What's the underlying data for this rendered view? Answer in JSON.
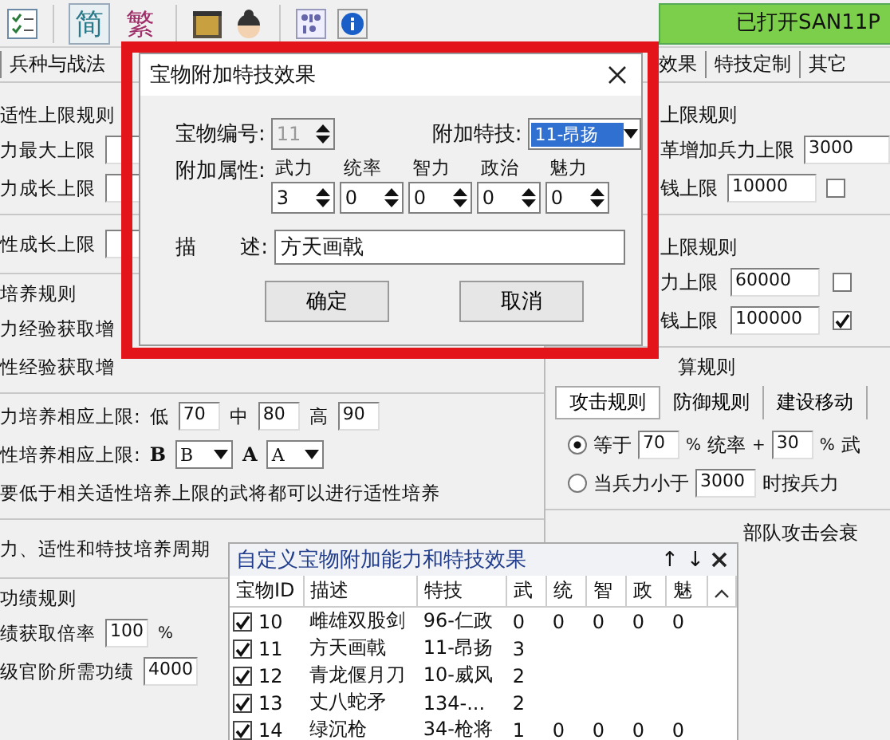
{
  "toolbar": {
    "script_buttons": [
      {
        "label": "简",
        "selected": true
      },
      {
        "label": "繁",
        "selected": false
      }
    ],
    "status": "已打开SAN11P"
  },
  "tabs_left": [
    {
      "label": "兵种与战法",
      "selected": false
    }
  ],
  "tabs_right": [
    {
      "label": "效果",
      "selected": false
    },
    {
      "label": "特技定制",
      "selected": false
    },
    {
      "label": "其它",
      "selected": false
    }
  ],
  "left_panel": {
    "sections": [
      {
        "heading": "适性上限规则",
        "rows": [
          {
            "items": [
              {
                "kind": "text",
                "text": "力最大上限"
              },
              {
                "kind": "field"
              }
            ]
          },
          {
            "items": [
              {
                "kind": "text",
                "text": "力成长上限"
              },
              {
                "kind": "field"
              }
            ]
          }
        ]
      },
      {
        "rows": [
          {
            "items": [
              {
                "kind": "text",
                "text": "性成长上限"
              },
              {
                "kind": "field"
              }
            ]
          }
        ]
      },
      {
        "heading": "培养规则",
        "rows": [
          {
            "items": [
              {
                "kind": "text",
                "text": "力经验获取增"
              }
            ]
          },
          {
            "items": [
              {
                "kind": "text",
                "text": "性经验获取增"
              }
            ]
          }
        ]
      },
      {
        "rows": [
          {
            "items": [
              {
                "kind": "text",
                "text": "力培养相应上限:"
              },
              {
                "kind": "text",
                "text": "低"
              },
              {
                "kind": "field",
                "value": "70"
              },
              {
                "kind": "text",
                "text": "中"
              },
              {
                "kind": "field",
                "value": "80"
              },
              {
                "kind": "text",
                "text": "高"
              },
              {
                "kind": "field",
                "value": "90"
              }
            ]
          },
          {
            "items": [
              {
                "kind": "text",
                "text": "性培养相应上限:"
              },
              {
                "kind": "bold",
                "text": "B"
              },
              {
                "kind": "select",
                "value": "B"
              },
              {
                "kind": "bold",
                "text": "A"
              },
              {
                "kind": "select",
                "value": "A"
              }
            ]
          },
          {
            "items": [
              {
                "kind": "text",
                "text": "要低于相关适性培养上限的武将都可以进行适性培养"
              }
            ]
          }
        ]
      },
      {
        "rows": [
          {
            "items": [
              {
                "kind": "text",
                "text": "力、适性和特技培养周期"
              }
            ]
          }
        ]
      },
      {
        "heading": "功绩规则",
        "rows": [
          {
            "items": [
              {
                "kind": "text",
                "text": "绩获取倍率"
              },
              {
                "kind": "field",
                "value": "100"
              },
              {
                "kind": "unit",
                "text": "%"
              }
            ]
          },
          {
            "items": [
              {
                "kind": "text",
                "text": "级官阶所需功绩"
              },
              {
                "kind": "field",
                "value": "4000"
              }
            ]
          }
        ]
      }
    ]
  },
  "right_panel": {
    "sections": [
      {
        "heading": "上限规则",
        "rows": [
          {
            "items": [
              {
                "kind": "text",
                "text": "革增加兵力上限"
              },
              {
                "kind": "field",
                "value": "3000"
              }
            ]
          },
          {
            "items": [
              {
                "kind": "text",
                "text": "钱上限"
              },
              {
                "kind": "field",
                "value": "10000"
              },
              {
                "kind": "check",
                "checked": false
              }
            ]
          }
        ]
      },
      {
        "heading": "上限规则",
        "rows": [
          {
            "items": [
              {
                "kind": "text",
                "text": "力上限"
              },
              {
                "kind": "field",
                "value": "60000"
              },
              {
                "kind": "check",
                "checked": false
              }
            ]
          },
          {
            "items": [
              {
                "kind": "text",
                "text": "钱上限"
              },
              {
                "kind": "field",
                "value": "100000"
              },
              {
                "kind": "check",
                "checked": true
              }
            ]
          }
        ]
      },
      {
        "heading": "算规则",
        "tabs": [
          {
            "label": "攻击规则",
            "selected": true
          },
          {
            "label": "防御规则",
            "selected": false
          },
          {
            "label": "建设移动",
            "selected": false
          }
        ],
        "rows": [
          {
            "items": [
              {
                "kind": "radio",
                "selected": true
              },
              {
                "kind": "text",
                "text": "等于"
              },
              {
                "kind": "field",
                "value": "70"
              },
              {
                "kind": "unit",
                "text": "%"
              },
              {
                "kind": "text",
                "text": "统率"
              },
              {
                "kind": "unit",
                "text": "+"
              },
              {
                "kind": "field",
                "value": "30"
              },
              {
                "kind": "unit",
                "text": "%"
              },
              {
                "kind": "text",
                "text": "武"
              }
            ]
          },
          {
            "items": [
              {
                "kind": "radio",
                "selected": false
              },
              {
                "kind": "text",
                "text": "当兵力小于"
              },
              {
                "kind": "field",
                "value": "3000"
              },
              {
                "kind": "text",
                "text": "时按兵力"
              }
            ]
          }
        ]
      },
      {
        "rows": [
          {
            "items": [
              {
                "kind": "text",
                "text": "部队攻击会衰"
              }
            ]
          }
        ]
      }
    ]
  },
  "dialog": {
    "title": "宝物附加特技效果",
    "id_label": "宝物编号:",
    "id_value": "11",
    "skill_label": "附加特技:",
    "skill_value": "11-昂扬",
    "attr_label": "附加属性:",
    "attributes": [
      {
        "name": "武力",
        "value": "3"
      },
      {
        "name": "统率",
        "value": "0"
      },
      {
        "name": "智力",
        "value": "0"
      },
      {
        "name": "政治",
        "value": "0"
      },
      {
        "name": "魅力",
        "value": "0"
      }
    ],
    "desc_label": [
      "描",
      "述:"
    ],
    "desc_value": "方天画戟",
    "buttons": [
      "确定",
      "取消"
    ]
  },
  "list_panel": {
    "title": "自定义宝物附加能力和特技效果",
    "controls": [
      "↑",
      "↓"
    ],
    "columns": [
      "宝物ID",
      "描述",
      "特技",
      "武",
      "统",
      "智",
      "政",
      "魅"
    ],
    "rows": [
      {
        "checked": true,
        "cells": [
          "10",
          "雌雄双股剑",
          "96-仁政",
          "0",
          "0",
          "0",
          "0",
          "0"
        ]
      },
      {
        "checked": true,
        "cells": [
          "11",
          "方天画戟",
          "11-昂扬",
          "3"
        ]
      },
      {
        "checked": true,
        "cells": [
          "12",
          "青龙偃月刀",
          "10-威风",
          "2"
        ]
      },
      {
        "checked": true,
        "cells": [
          "13",
          "丈八蛇矛",
          "134-...",
          "2"
        ]
      },
      {
        "checked": true,
        "cells": [
          "14",
          "绿沉枪",
          "34-枪将",
          "1",
          "0",
          "0",
          "0",
          "0"
        ]
      }
    ]
  }
}
